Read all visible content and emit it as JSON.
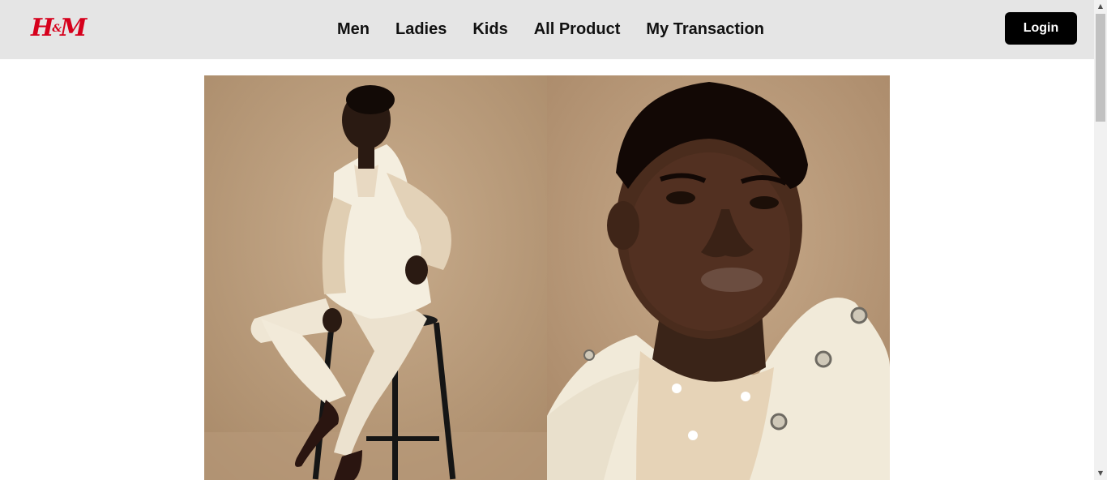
{
  "brand": {
    "logo_main": "H",
    "logo_amp": "&",
    "logo_end": "M",
    "color": "#d6001c"
  },
  "nav": {
    "items": [
      {
        "label": "Men"
      },
      {
        "label": "Ladies"
      },
      {
        "label": "Kids"
      },
      {
        "label": "All Product"
      },
      {
        "label": "My Transaction"
      }
    ]
  },
  "auth": {
    "login_label": "Login"
  },
  "hero": {
    "images": [
      {
        "name": "model-seated-on-stool-photo"
      },
      {
        "name": "model-portrait-closeup-photo"
      }
    ]
  },
  "scrollbar": {
    "up_icon": "▲",
    "down_icon": "▼"
  }
}
